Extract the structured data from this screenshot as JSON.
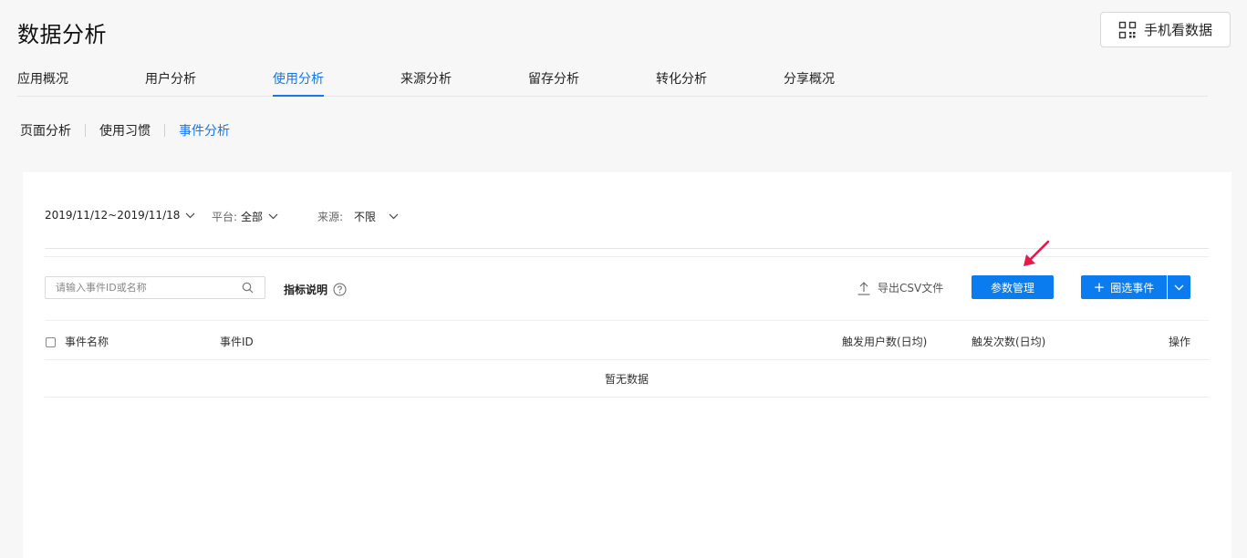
{
  "header": {
    "title": "数据分析",
    "mobile_button": "手机看数据"
  },
  "main_tabs": [
    {
      "label": "应用概况"
    },
    {
      "label": "用户分析"
    },
    {
      "label": "使用分析",
      "active": true
    },
    {
      "label": "来源分析"
    },
    {
      "label": "留存分析"
    },
    {
      "label": "转化分析"
    },
    {
      "label": "分享概况"
    }
  ],
  "sub_tabs": [
    {
      "label": "页面分析"
    },
    {
      "label": "使用习惯"
    },
    {
      "label": "事件分析",
      "active": true
    }
  ],
  "filters": {
    "date_range": "2019/11/12~2019/11/18",
    "platform_label": "平台:",
    "platform_value": "全部",
    "source_label": "来源:",
    "source_value": "不限"
  },
  "toolbar": {
    "search_placeholder": "请输入事件ID或名称",
    "search_value": "",
    "metric_help": "指标说明",
    "export_label": "导出CSV文件",
    "param_button": "参数管理",
    "select_button": "圈选事件"
  },
  "table": {
    "columns": [
      "事件名称",
      "事件ID",
      "触发用户数(日均)",
      "触发次数(日均)",
      "操作"
    ],
    "empty_text": "暂无数据"
  },
  "colors": {
    "accent": "#1677e8",
    "primary_button": "#0b7cf0",
    "annotation_arrow": "#e8194a"
  }
}
